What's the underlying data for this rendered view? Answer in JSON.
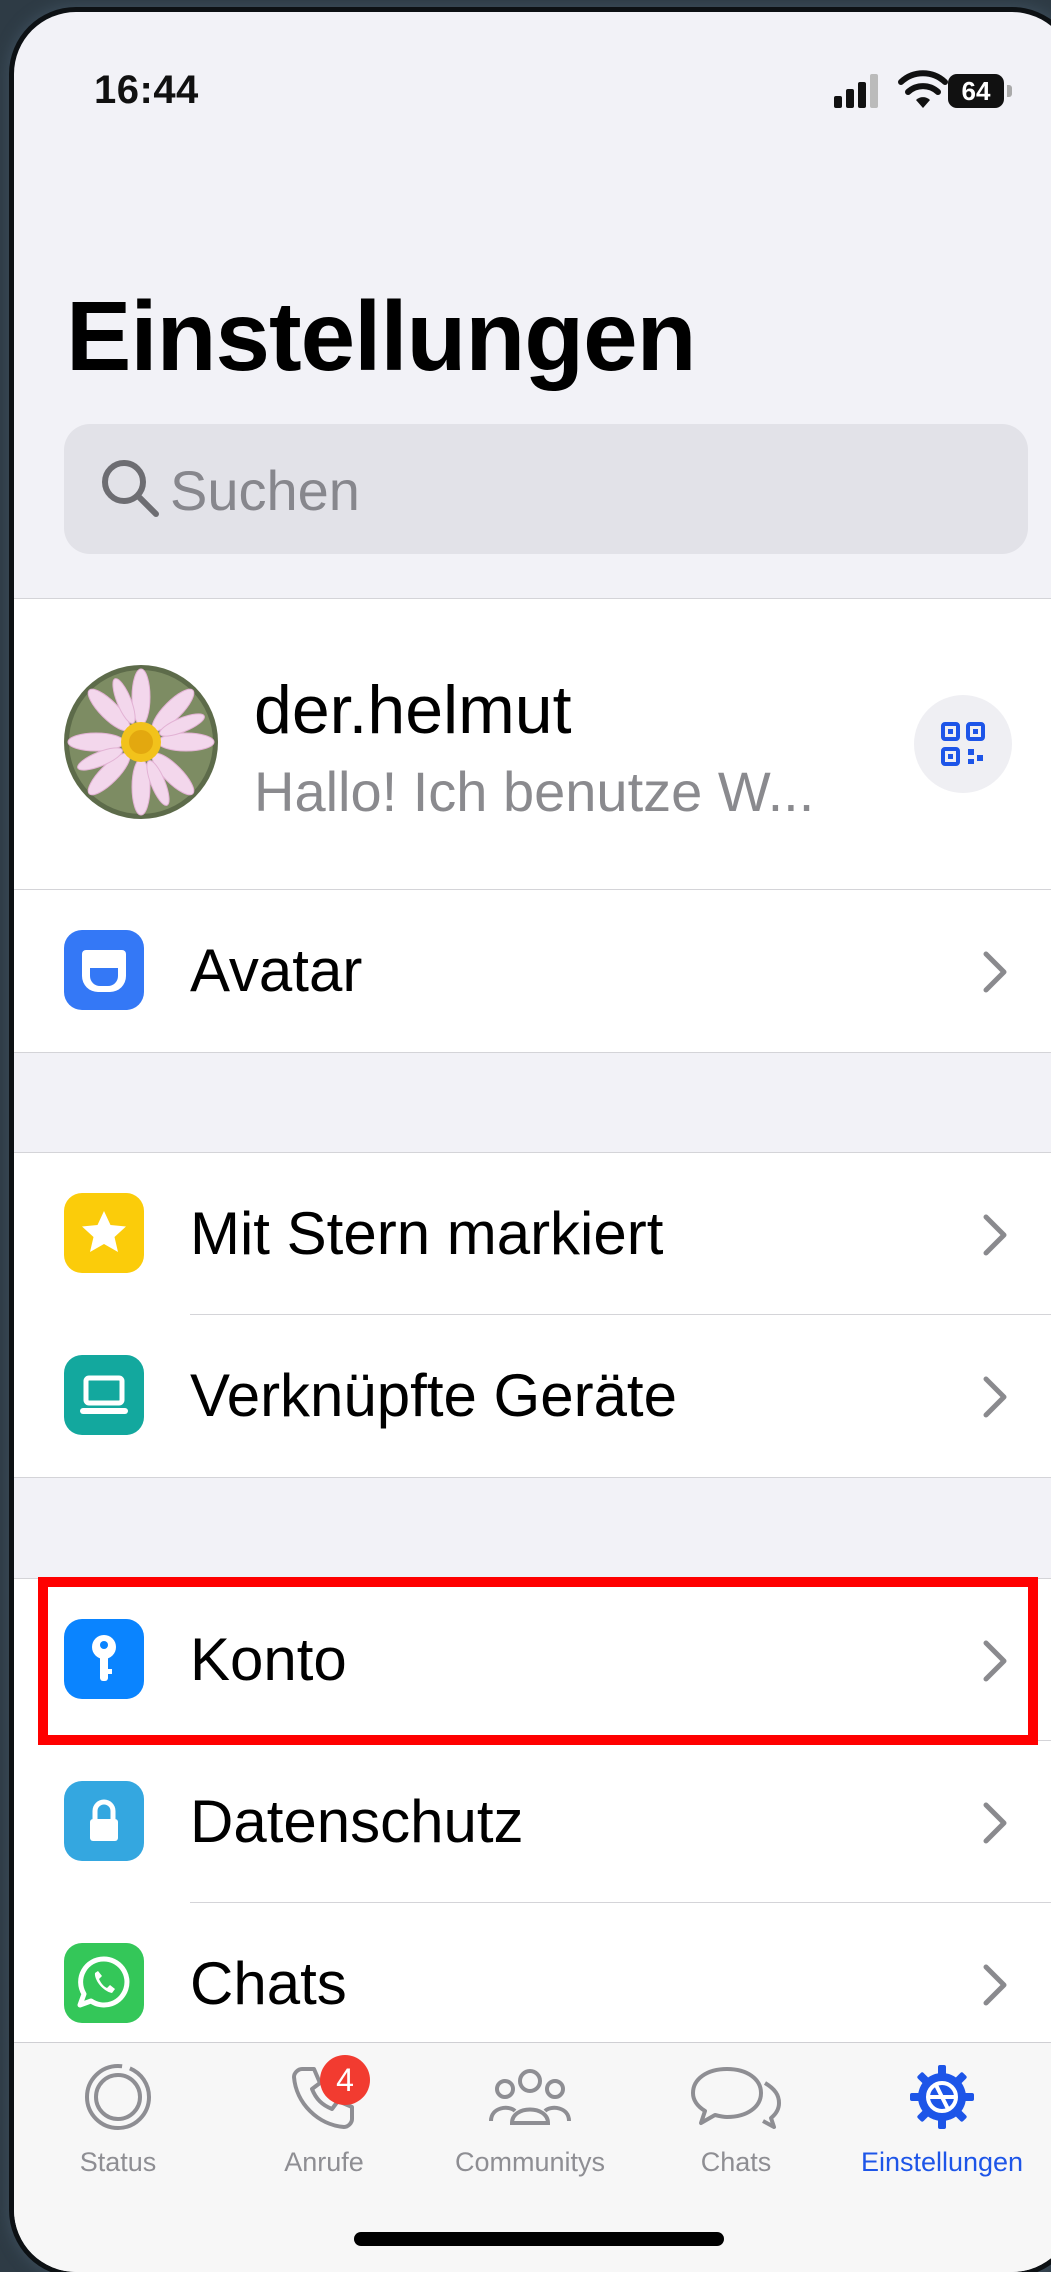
{
  "status_bar": {
    "time": "16:44",
    "battery": "64"
  },
  "page_title": "Einstellungen",
  "search": {
    "placeholder": "Suchen"
  },
  "profile": {
    "name": "der.helmut",
    "status": "Hallo! Ich benutze W..."
  },
  "groups": [
    {
      "items": [
        {
          "label": "Avatar",
          "icon": "avatar-icon",
          "color": "#3478f6"
        }
      ]
    },
    {
      "items": [
        {
          "label": "Mit Stern markiert",
          "icon": "star-icon",
          "color": "#fbcc0a"
        },
        {
          "label": "Verknüpfte Geräte",
          "icon": "laptop-icon",
          "color": "#13a89e"
        }
      ]
    },
    {
      "items": [
        {
          "label": "Konto",
          "icon": "key-icon",
          "color": "#0a84ff"
        },
        {
          "label": "Datenschutz",
          "icon": "lock-icon",
          "color": "#34a7e0"
        },
        {
          "label": "Chats",
          "icon": "whatsapp-icon",
          "color": "#34c759"
        }
      ]
    }
  ],
  "tabbar": {
    "tabs": [
      {
        "label": "Status",
        "icon": "status-icon"
      },
      {
        "label": "Anrufe",
        "icon": "phone-icon",
        "badge": "4"
      },
      {
        "label": "Communitys",
        "icon": "communities-icon"
      },
      {
        "label": "Chats",
        "icon": "chats-icon"
      },
      {
        "label": "Einstellungen",
        "icon": "settings-icon",
        "active": true
      }
    ]
  },
  "colors": {
    "accent": "#1d55e8",
    "highlight": "#ff0000",
    "badge": "#f23b30"
  }
}
